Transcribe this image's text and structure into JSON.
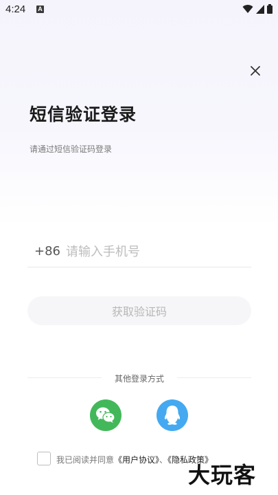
{
  "status_bar": {
    "time": "4:24",
    "notification_icon": "A"
  },
  "header": {
    "title": "短信验证登录",
    "subtitle": "请通过短信验证码登录"
  },
  "phone": {
    "country_code": "+86",
    "placeholder": "请输入手机号",
    "value": ""
  },
  "get_code_label": "获取验证码",
  "other_login": {
    "label": "其他登录方式",
    "methods": [
      {
        "name": "wechat",
        "icon": "wechat-icon",
        "color": "#43b85a"
      },
      {
        "name": "qq",
        "icon": "qq-icon",
        "color": "#44a9f0"
      }
    ]
  },
  "agreement": {
    "prefix": "我已阅读并同意",
    "user_agreement": "《用户协议》",
    "separator": "、",
    "privacy_policy": "《隐私政策》",
    "checked": false
  },
  "watermark": "大玩客",
  "colors": {
    "accent_wechat": "#43b85a",
    "accent_qq": "#44a9f0",
    "button_bg": "#f6f6f8"
  }
}
